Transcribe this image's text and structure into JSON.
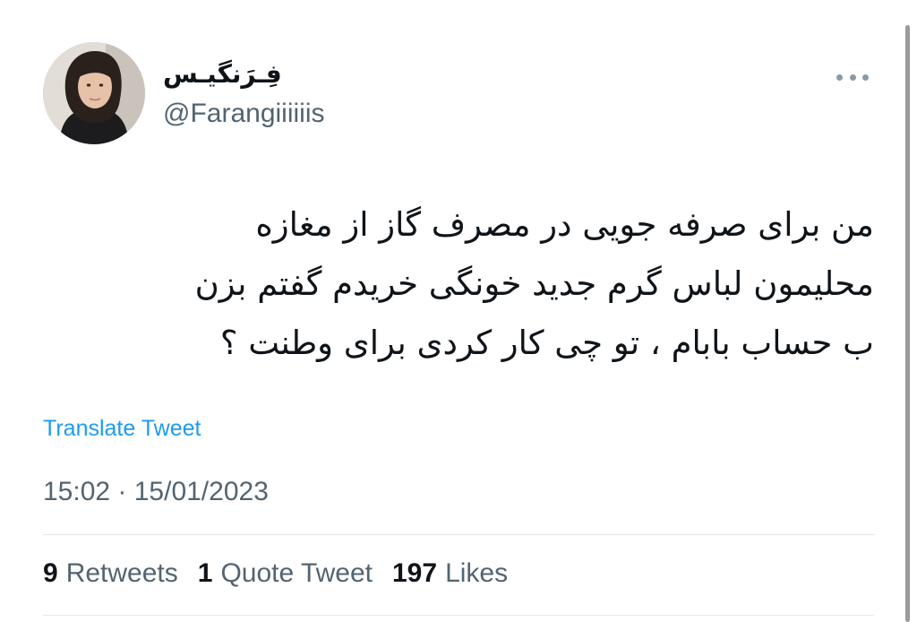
{
  "author": {
    "display_name": "فِـرَنگیـس",
    "handle": "@Farangiiiiiis",
    "avatar_icon": "profile-photo"
  },
  "tweet": {
    "text_lines": [
      "من برای صرفه جویی در مصرف گاز از مغازه",
      "محلیمون لباس گرم جدید خونگی خریدم گفتم بزن",
      "ب حساب بابام ، تو چی کار کردی برای وطنت ؟"
    ],
    "translate_label": "Translate Tweet",
    "timestamp": "15:02 · 15/01/2023"
  },
  "stats": {
    "retweets_count": "9",
    "retweets_label": "Retweets",
    "quotes_count": "1",
    "quotes_label": "Quote Tweet",
    "likes_count": "197",
    "likes_label": "Likes"
  },
  "colors": {
    "link": "#1d9bf0",
    "secondary_text": "#536471",
    "primary_text": "#0f1419"
  },
  "icons": {
    "more": "more-horizontal-icon"
  }
}
